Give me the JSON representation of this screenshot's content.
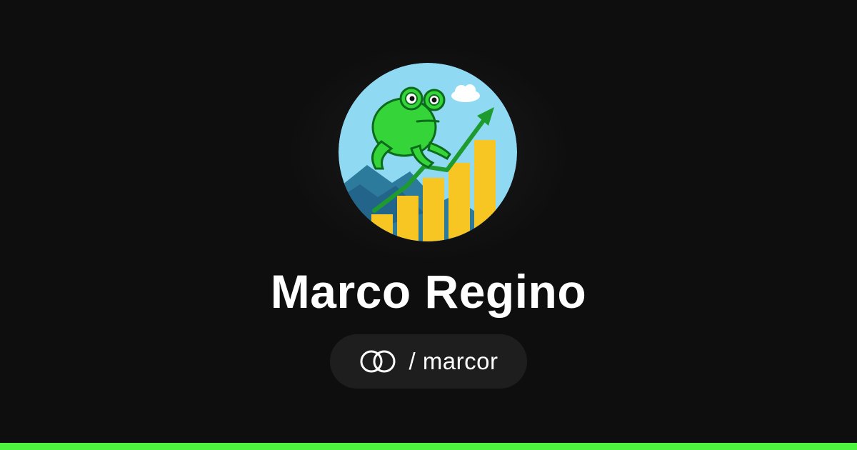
{
  "profile": {
    "name": "Marco Regino",
    "handle": "/ marcor",
    "avatar_icon": "frog-stock-chart-avatar",
    "logo_icon": "linked-rings-logo-icon"
  },
  "colors": {
    "background": "#0e0e0e",
    "pill": "#1e1e1e",
    "accent_bar": "#4df53e",
    "text": "#ffffff"
  }
}
